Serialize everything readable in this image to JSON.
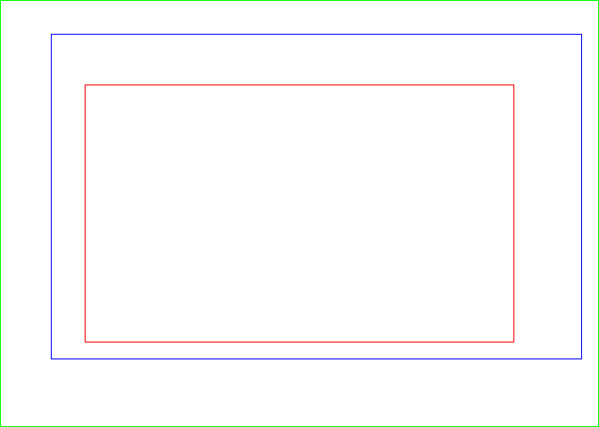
{
  "colors": {
    "page_border": "#00ff00",
    "outer_region": "#0000ff",
    "inner_region": "#ff0000"
  }
}
